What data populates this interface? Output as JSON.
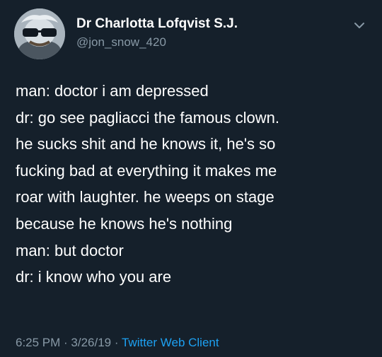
{
  "author": {
    "display_name": "Dr Charlotta Lofqvist S.J.",
    "handle": "@jon_snow_420",
    "avatar_icon": "avatar-image"
  },
  "tweet": {
    "lines": [
      "man: doctor i am depressed",
      "dr: go see pagliacci the famous clown.",
      "he sucks shit and he knows it, he's so",
      "fucking bad at everything it makes me",
      "roar with laughter. he weeps on stage",
      "because he knows he's nothing",
      "man: but doctor",
      "dr: i know who you are"
    ]
  },
  "meta": {
    "time": "6:25 PM",
    "separator": " · ",
    "date": "3/26/19",
    "client": "Twitter Web Client"
  },
  "colors": {
    "background": "#15202b",
    "text": "#ffffff",
    "secondary": "#8899a6",
    "link": "#1da1f2"
  },
  "icons": {
    "menu": "chevron-down-icon"
  }
}
